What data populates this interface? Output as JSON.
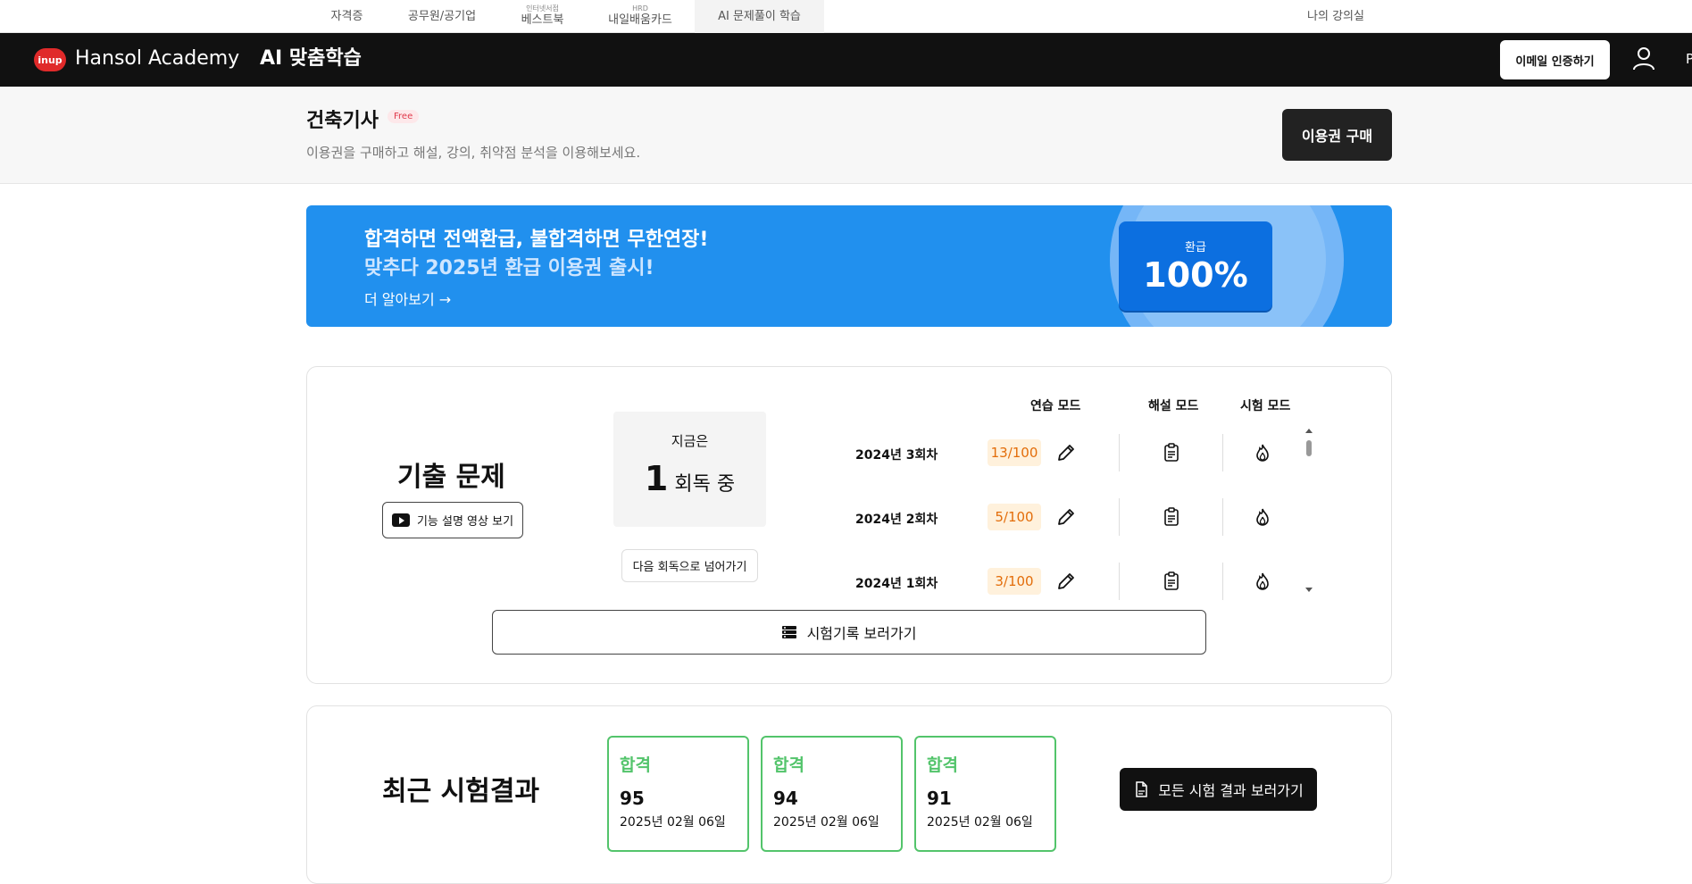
{
  "topnav": {
    "items": [
      {
        "sup": "",
        "label": "자격증"
      },
      {
        "sup": "",
        "label": "공무원/공기업"
      },
      {
        "sup": "인터넷서점",
        "label": "베스트북"
      },
      {
        "sup": "HRD",
        "label": "내일배움카드"
      },
      {
        "sup": "",
        "label": "AI 문제풀이 학습"
      }
    ],
    "my_classroom": "나의 강의실"
  },
  "header": {
    "logo_text": "inup",
    "brand": "Hansol Academy",
    "service": "AI 맞춤학습",
    "email_verify": "이메일 인증하기",
    "cut_text": "P"
  },
  "title_section": {
    "title": "건축기사",
    "badge": "Free",
    "subtitle": "이용권을 구매하고 해설, 강의, 취약점 분석을 이용해보세요.",
    "buy_button": "이용권 구매"
  },
  "banner": {
    "line1": "합격하면 전액환급, 불합격하면 무한연장!",
    "line2": "맞추다 2025년 환급 이용권 출시!",
    "more": "더 알아보기 →",
    "ticket_label": "환급",
    "ticket_value": "100%"
  },
  "past_exams": {
    "title": "기출 문제",
    "video_button": "기능 설명 영상 보기",
    "status_now": "지금은",
    "status_round": "1",
    "status_suffix": "회독 중",
    "next_round_button": "다음 회독으로 넘어가기",
    "mode_headers": [
      "연습 모드",
      "해설 모드",
      "시험 모드"
    ],
    "rows": [
      {
        "label": "2024년 3회차",
        "score": "13/100"
      },
      {
        "label": "2024년 2회차",
        "score": "5/100"
      },
      {
        "label": "2024년 1회차",
        "score": "3/100"
      }
    ],
    "history_button": "시험기록 보러가기"
  },
  "recent_results": {
    "title": "최근 시험결과",
    "cards": [
      {
        "status": "합격",
        "score": "95",
        "date": "2025년 02월 06일"
      },
      {
        "status": "합격",
        "score": "94",
        "date": "2025년 02월 06일"
      },
      {
        "status": "합격",
        "score": "91",
        "date": "2025년 02월 06일"
      }
    ],
    "all_results_button": "모든 시험 결과 보러가기"
  },
  "colors": {
    "accent_blue": "#2190ee",
    "pass_green": "#53c46b",
    "score_orange": "#e36d0a"
  }
}
